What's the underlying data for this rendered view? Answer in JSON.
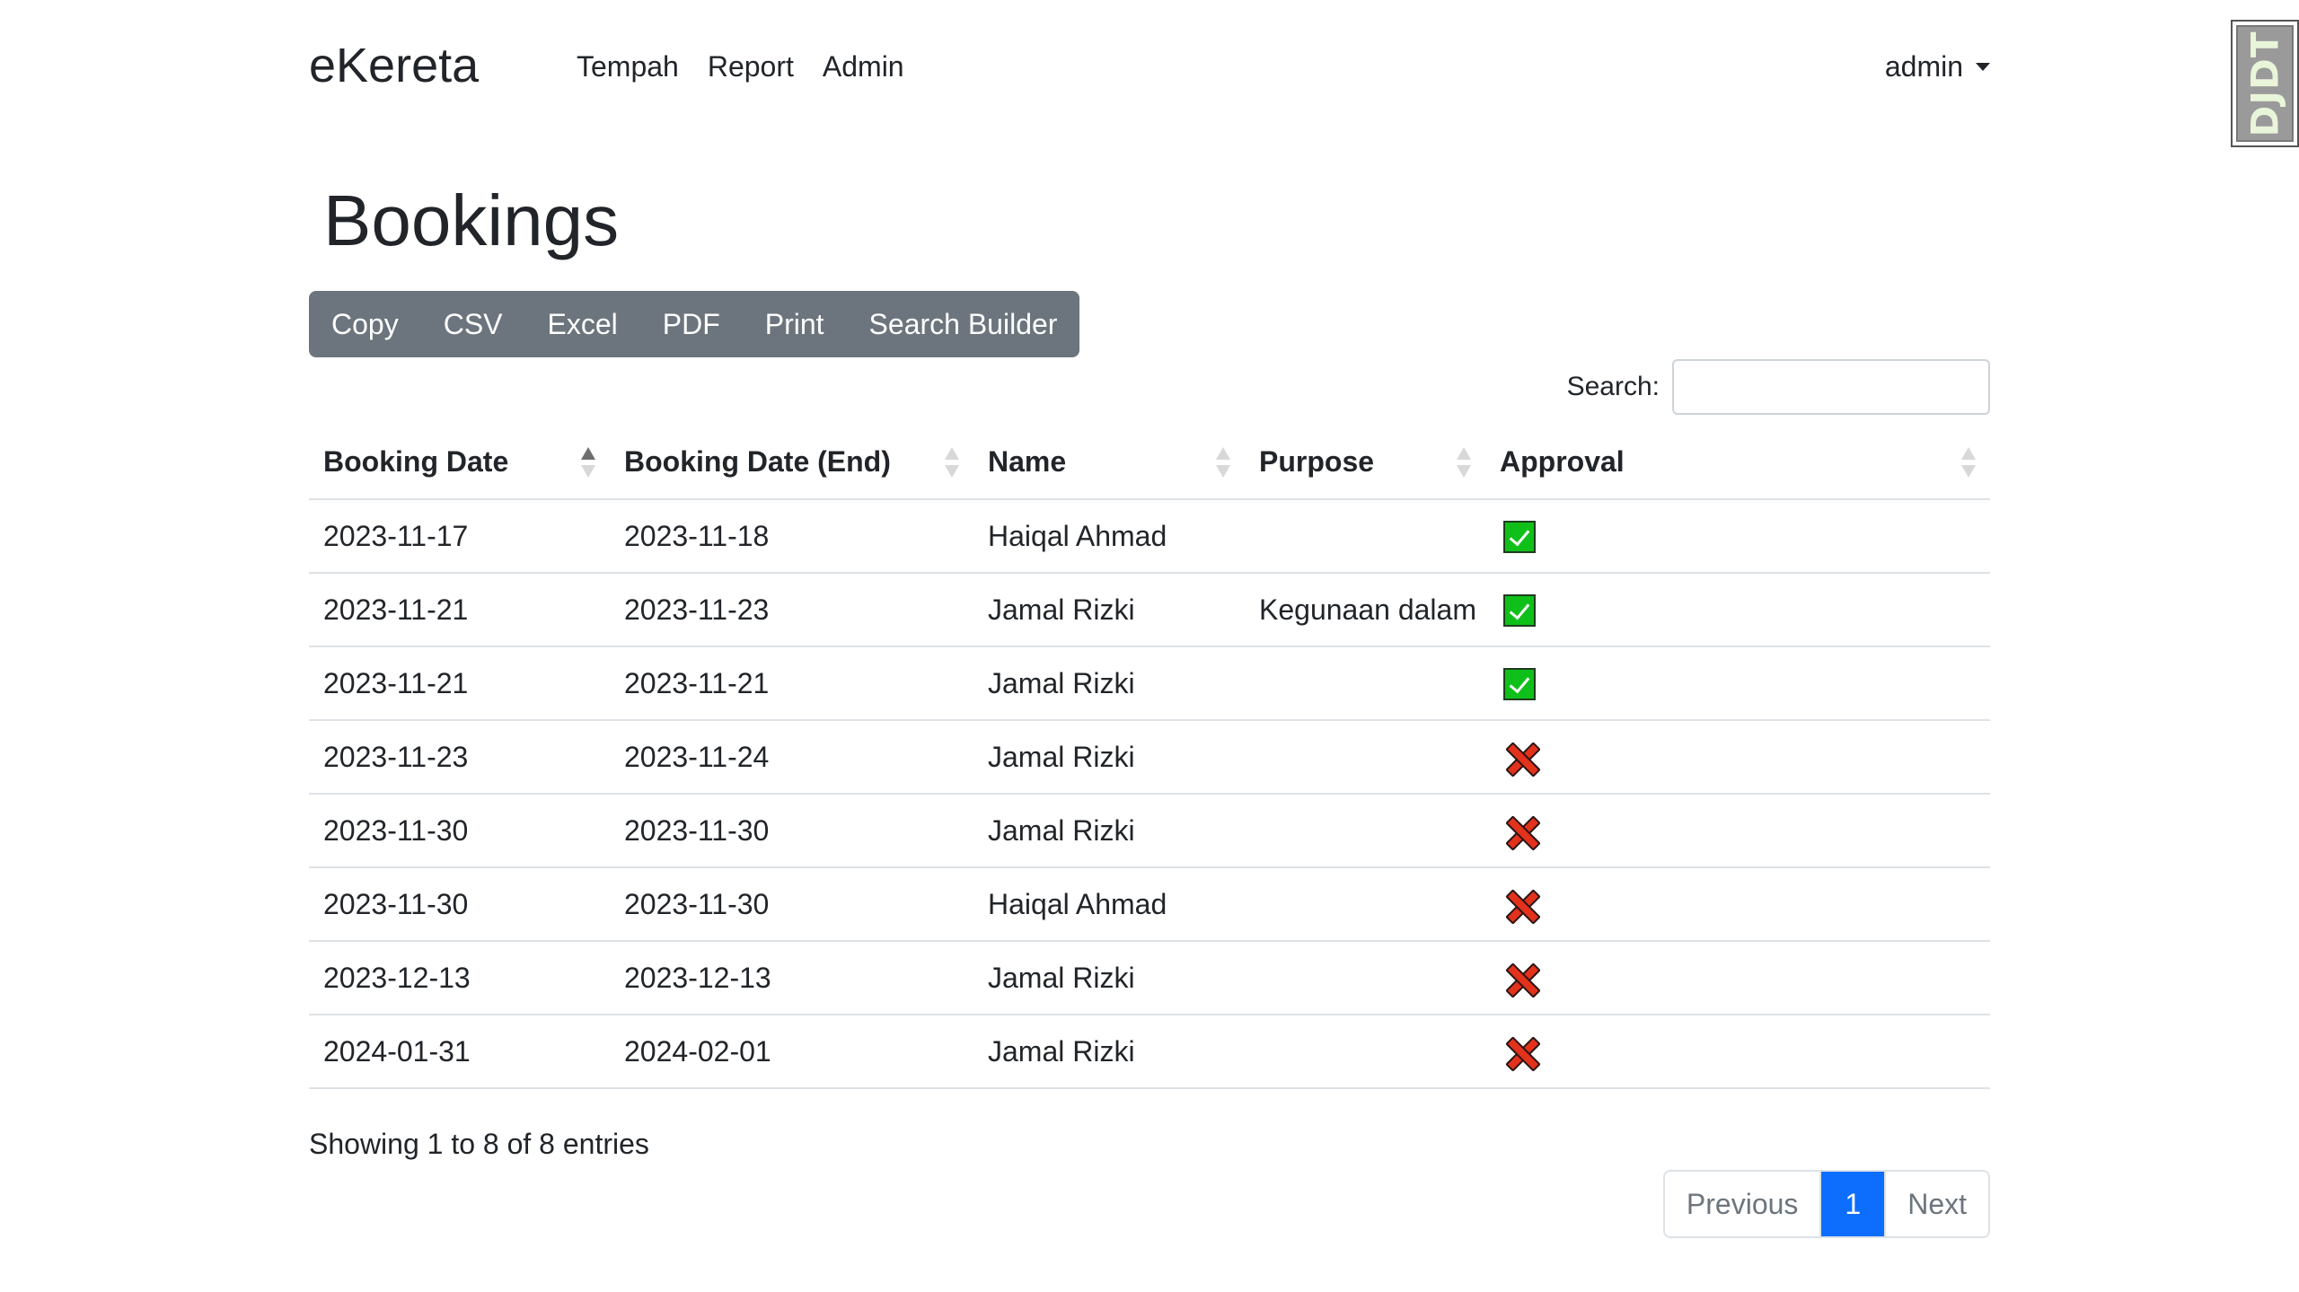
{
  "navbar": {
    "brand": "eKereta",
    "links": [
      "Tempah",
      "Report",
      "Admin"
    ],
    "user": "admin"
  },
  "debug_toolbar": {
    "label": "DJDT"
  },
  "page": {
    "title": "Bookings"
  },
  "export_buttons": [
    "Copy",
    "CSV",
    "Excel",
    "PDF",
    "Print",
    "Search Builder"
  ],
  "search": {
    "label": "Search:",
    "value": ""
  },
  "table": {
    "columns": [
      "Booking Date",
      "Booking Date (End)",
      "Name",
      "Purpose",
      "Approval"
    ],
    "sorted_column": "Booking Date",
    "sort_direction": "ascending",
    "rows": [
      {
        "start": "2023-11-17",
        "end": "2023-11-18",
        "name": "Haiqal Ahmad",
        "purpose": "",
        "approval": "approved"
      },
      {
        "start": "2023-11-21",
        "end": "2023-11-23",
        "name": "Jamal Rizki",
        "purpose": "Kegunaan dalam",
        "approval": "approved"
      },
      {
        "start": "2023-11-21",
        "end": "2023-11-21",
        "name": "Jamal Rizki",
        "purpose": "",
        "approval": "approved"
      },
      {
        "start": "2023-11-23",
        "end": "2023-11-24",
        "name": "Jamal Rizki",
        "purpose": "",
        "approval": "rejected"
      },
      {
        "start": "2023-11-30",
        "end": "2023-11-30",
        "name": "Jamal Rizki",
        "purpose": "",
        "approval": "rejected"
      },
      {
        "start": "2023-11-30",
        "end": "2023-11-30",
        "name": "Haiqal Ahmad",
        "purpose": "",
        "approval": "rejected"
      },
      {
        "start": "2023-12-13",
        "end": "2023-12-13",
        "name": "Jamal Rizki",
        "purpose": "",
        "approval": "rejected"
      },
      {
        "start": "2024-01-31",
        "end": "2024-02-01",
        "name": "Jamal Rizki",
        "purpose": "",
        "approval": "rejected"
      }
    ]
  },
  "info": "Showing 1 to 8 of 8 entries",
  "pagination": {
    "previous": "Previous",
    "current": "1",
    "next": "Next"
  },
  "colors": {
    "approved": "#10c01a",
    "rejected": "#e2321c",
    "primary": "#0d6efd",
    "button_group": "#6c757d"
  }
}
